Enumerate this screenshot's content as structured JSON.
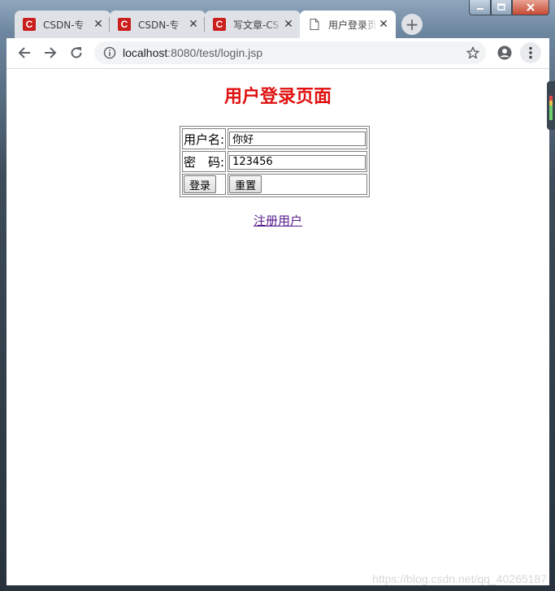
{
  "browser": {
    "tabs": [
      {
        "title": "CSDN-专",
        "favicon": "csdn-icon",
        "active": false
      },
      {
        "title": "CSDN-专",
        "favicon": "csdn-icon",
        "active": false
      },
      {
        "title": "写文章-CS",
        "favicon": "csdn-icon",
        "active": false
      },
      {
        "title": "用户登录页",
        "favicon": "page-icon",
        "active": true
      }
    ],
    "new_tab_icon": "plus-icon",
    "address": {
      "host": "localhost",
      "rest": ":8080/test/login.jsp"
    },
    "icons": [
      "back-arrow-icon",
      "forward-arrow-icon",
      "reload-icon",
      "info-icon",
      "star-icon",
      "account-icon",
      "menu-kebab-icon"
    ]
  },
  "page": {
    "heading": "用户登录页面",
    "heading_color": "#e01010",
    "form": {
      "username_label": "用户名:",
      "username_value": "你好",
      "password_label": "密　码:",
      "password_value": "123456",
      "login_button": "登录",
      "reset_button": "重置"
    },
    "register_link": "注册用户"
  },
  "watermark": "https://blog.csdn.net/qq_40265187"
}
